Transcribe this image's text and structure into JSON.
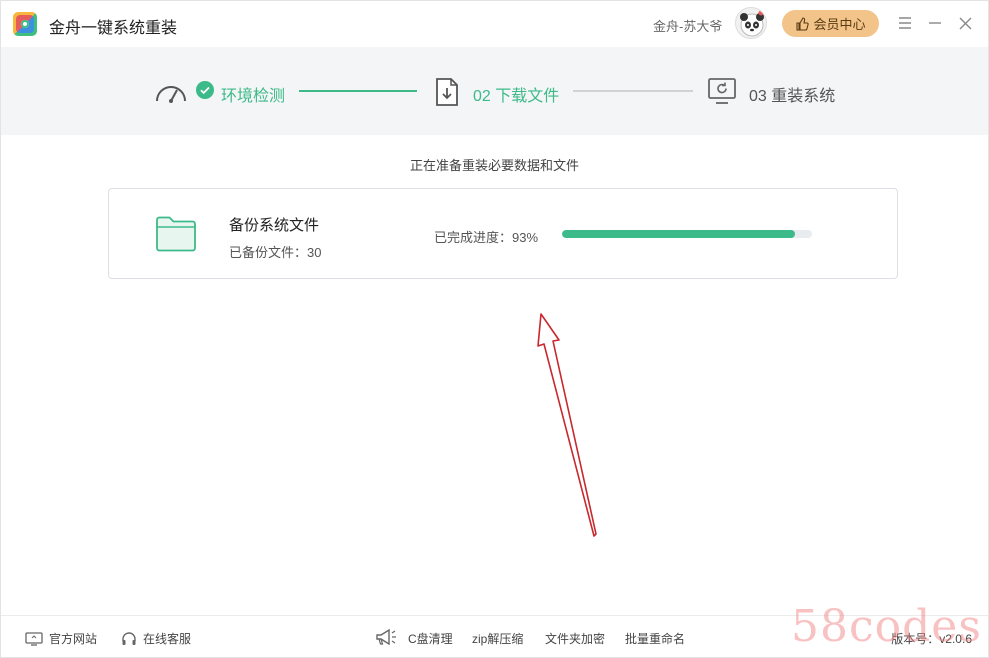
{
  "app": {
    "title": "金舟一键系统重装"
  },
  "user": {
    "name": "金舟-苏大爷",
    "vip_label": "会员中心"
  },
  "steps": [
    {
      "label": "环境检测",
      "state": "done"
    },
    {
      "label": "02 下载文件",
      "state": "active"
    },
    {
      "label": "03 重装系统",
      "state": "pending"
    }
  ],
  "status": {
    "message": "正在准备重装必要数据和文件"
  },
  "task": {
    "title": "备份系统文件",
    "subtitle": "已备份文件：30",
    "progress_label": "已完成进度：93%",
    "progress": 0.93
  },
  "footer": {
    "official_site": "官方网站",
    "online_service": "在线客服",
    "tools": [
      "C盘清理",
      "zip解压缩",
      "文件夹加密",
      "批量重命名"
    ],
    "version": "版本号：v2.0.6"
  },
  "watermark": "58codes",
  "colors": {
    "accent": "#3dba8a",
    "vip": "#f2c48a",
    "steps_bg": "#f4f5f6",
    "annotation": "#c8282e"
  }
}
